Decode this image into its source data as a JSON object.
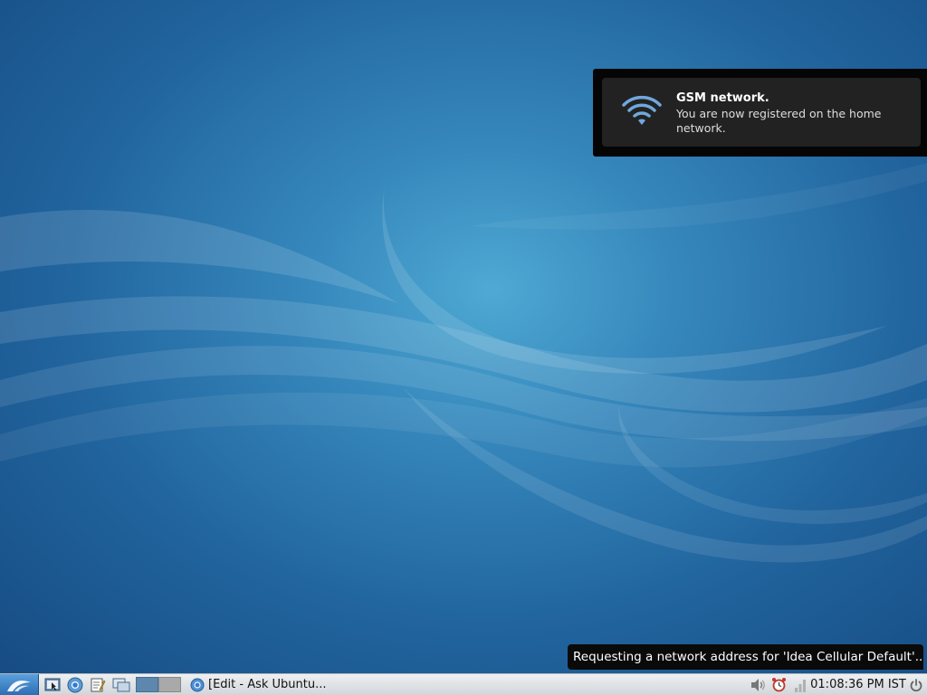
{
  "notification": {
    "title": "GSM network.",
    "body": "You are now registered on the home network.",
    "icon": "wifi-signal-icon"
  },
  "tooltip": {
    "text": "Requesting a network address for 'Idea Cellular Default'..."
  },
  "taskbar": {
    "menu_icon": "lubuntu-menu-icon",
    "launchers": [
      {
        "name": "file-manager-icon"
      },
      {
        "name": "browser-icon"
      },
      {
        "name": "text-editor-icon"
      },
      {
        "name": "show-desktop-icon"
      }
    ],
    "workspaces": [
      {
        "active": true
      },
      {
        "active": false
      }
    ],
    "window_button": {
      "label": "[Edit - Ask Ubuntu...",
      "icon": "chromium-icon"
    },
    "tray": {
      "volume_icon": "speaker-icon",
      "alarm_icon": "alarm-clock-icon",
      "network_icon": "network-connecting-icon",
      "power_icon": "power-icon"
    },
    "clock": "01:08:36 PM IST"
  },
  "colors": {
    "desktop_center": "#4ea9d3",
    "desktop_edge": "#174c83",
    "notification_bg": "#222222",
    "taskbar_bg": "#e1e4e7"
  }
}
